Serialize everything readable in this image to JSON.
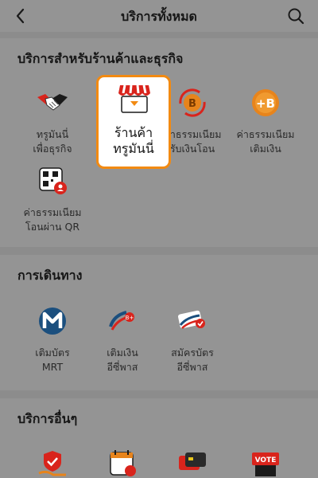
{
  "header": {
    "title": "บริการทั้งหมด"
  },
  "sections": {
    "business": {
      "title": "บริการสำหรับร้านค้าและธุรกิจ",
      "items": [
        {
          "label": "ทรูมันนี่\nเพื่อธุรกิจ"
        },
        {
          "label": "ร้านค้า\nทรูมันนี่"
        },
        {
          "label": "ค่าธรรมเนียม\nรับเงินโอน"
        },
        {
          "label": "ค่าธรรมเนียม\nเติมเงิน"
        },
        {
          "label": "ค่าธรรมเนียม\nโอนผ่าน QR"
        }
      ]
    },
    "travel": {
      "title": "การเดินทาง",
      "items": [
        {
          "label": "เติมบัตร\nMRT"
        },
        {
          "label": "เติมเงิน\nอีซี่พาส"
        },
        {
          "label": "สมัครบัตร\nอีซี่พาส"
        }
      ]
    },
    "other": {
      "title": "บริการอื่นๆ",
      "items": [
        {
          "label": ""
        },
        {
          "label": ""
        },
        {
          "label": ""
        },
        {
          "label": ""
        }
      ],
      "vote_text": "VOTE"
    }
  },
  "colors": {
    "accent": "#f28a12",
    "brand_red": "#e0281e",
    "mrt_blue": "#1b4f7e"
  }
}
